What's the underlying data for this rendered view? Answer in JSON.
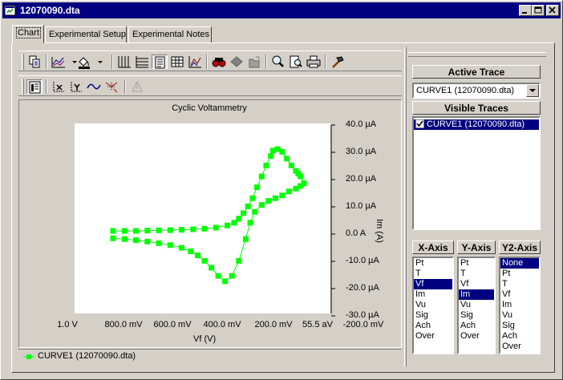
{
  "window": {
    "title": "12070090.dta",
    "icon": "app-window-icon"
  },
  "tabs": [
    {
      "label": "Chart",
      "active": true
    },
    {
      "label": "Experimental Setup",
      "active": false
    },
    {
      "label": "Experimental Notes",
      "active": false
    }
  ],
  "chart": {
    "title": "Cyclic Voltammetry",
    "xlabel": "Vf (V)",
    "ylabel": "Im (A)",
    "x_ticks": [
      "1.0 V",
      "800.0 mV",
      "600.0 mV",
      "400.0 mV",
      "200.0 mV",
      "55.5 aV",
      "-200.0 mV"
    ],
    "y_ticks": [
      "40.0 µA",
      "30.0 µA",
      "20.0 µA",
      "10.0 µA",
      "0.0 A",
      "-10.0 µA",
      "-20.0 µA",
      "-30.0 µA"
    ],
    "legend_label": "CURVE1 (12070090.dta)",
    "series_color": "#00ff00"
  },
  "chart_data": {
    "type": "line",
    "title": "Cyclic Voltammetry",
    "xlabel": "Vf (V)",
    "ylabel": "Im (A)",
    "x_axis_reversed": true,
    "xlim": [
      1.0,
      -0.2
    ],
    "ylim": [
      -30,
      40
    ],
    "y_units": "µA",
    "series": [
      {
        "name": "CURVE1 (12070090.dta)",
        "x": [
          0.8,
          0.75,
          0.7,
          0.65,
          0.6,
          0.55,
          0.5,
          0.45,
          0.4,
          0.35,
          0.3,
          0.27,
          0.25,
          0.23,
          0.21,
          0.19,
          0.17,
          0.15,
          0.13,
          0.11,
          0.1,
          0.08,
          0.06,
          0.04,
          0.02,
          0.0,
          -0.01,
          -0.02,
          -0.035,
          -0.02,
          0.0,
          0.03,
          0.06,
          0.09,
          0.12,
          0.15,
          0.18,
          0.2,
          0.22,
          0.25,
          0.28,
          0.31,
          0.34,
          0.37,
          0.4,
          0.43,
          0.46,
          0.5,
          0.55,
          0.6,
          0.65,
          0.7,
          0.75,
          0.8
        ],
        "y": [
          0.0,
          0.0,
          0.0,
          0.1,
          0.2,
          0.3,
          0.4,
          0.6,
          0.8,
          1.2,
          2.0,
          3.0,
          4.5,
          6.5,
          9.0,
          12.0,
          16.0,
          20.0,
          24.0,
          27.5,
          29.5,
          30.0,
          29.0,
          26.5,
          24.0,
          22.0,
          21.0,
          20.0,
          17.5,
          16.5,
          15.5,
          14.5,
          13.0,
          12.0,
          11.0,
          9.5,
          7.0,
          3.0,
          -3.0,
          -11.0,
          -16.5,
          -18.5,
          -16.5,
          -13.5,
          -11.0,
          -9.0,
          -7.5,
          -6.2,
          -5.2,
          -4.5,
          -3.9,
          -3.4,
          -3.0,
          -2.7
        ]
      }
    ],
    "grid": false,
    "legend": "bottom-left"
  },
  "right_panel": {
    "active_trace_label": "Active Trace",
    "active_trace_value": "CURVE1 (12070090.dta)",
    "visible_traces_label": "Visible Traces",
    "visible_traces": [
      {
        "label": "CURVE1 (12070090.dta)",
        "checked": true
      }
    ],
    "x_axis": {
      "label": "X-Axis",
      "options": [
        "Pt",
        "T",
        "Vf",
        "Im",
        "Vu",
        "Sig",
        "Ach",
        "Over"
      ],
      "selected": "Vf"
    },
    "y_axis": {
      "label": "Y-Axis",
      "options": [
        "Pt",
        "T",
        "Vf",
        "Im",
        "Vu",
        "Sig",
        "Ach",
        "Over"
      ],
      "selected": "Im"
    },
    "y2_axis": {
      "label": "Y2-Axis",
      "options": [
        "None",
        "Pt",
        "T",
        "Vf",
        "Im",
        "Vu",
        "Sig",
        "Ach",
        "Over"
      ],
      "selected": "None"
    }
  },
  "toolbar": {
    "row1": [
      "copy-icon",
      "line-style-icon",
      "fill-color-icon",
      "x-grid-icon",
      "y-grid-icon",
      "legend-icon",
      "data-table-icon",
      "axis-scale-icon",
      "binoculars-icon",
      "marker-icon",
      "open-data-icon",
      "zoom-icon",
      "print-preview-icon",
      "print-icon",
      "tools-icon"
    ],
    "row2": [
      "chart-properties-icon",
      "x-axis-icon",
      "y-axis-icon",
      "curve-fit-icon",
      "cursor-icon",
      "annotate-icon"
    ]
  }
}
